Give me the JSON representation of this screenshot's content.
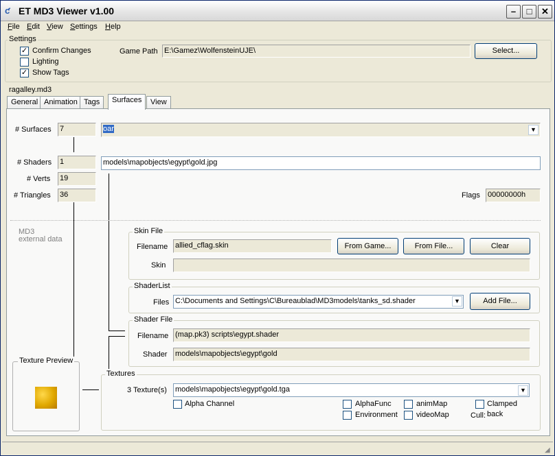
{
  "window": {
    "title": "ET MD3 Viewer v1.00"
  },
  "menu": [
    "File",
    "Edit",
    "View",
    "Settings",
    "Help"
  ],
  "settings": {
    "group_title": "Settings",
    "confirm_changes": {
      "label": "Confirm Changes",
      "checked": true
    },
    "lighting": {
      "label": "Lighting",
      "checked": false
    },
    "show_tags": {
      "label": "Show Tags",
      "checked": true
    },
    "game_path_label": "Game Path",
    "game_path_value": "E:\\Gamez\\WolfensteinUJE\\",
    "select_button": "Select..."
  },
  "file_name": "ragalley.md3",
  "tabs": [
    "General",
    "Animation",
    "Tags",
    "Surfaces",
    "View"
  ],
  "active_tab": "Surfaces",
  "surfaces": {
    "surfaces_label": "# Surfaces",
    "surfaces_value": "7",
    "surface_name": "oar",
    "shaders_label": "# Shaders",
    "shaders_value": "1",
    "shader_path": "models\\mapobjects\\egypt\\gold.jpg",
    "verts_label": "# Verts",
    "verts_value": "19",
    "triangles_label": "# Triangles",
    "triangles_value": "36",
    "flags_label": "Flags",
    "flags_value": "00000000h",
    "md3_line1": "MD3",
    "md3_line2": "external data",
    "texture_preview_title": "Texture Preview"
  },
  "skin_file": {
    "title": "Skin File",
    "filename_label": "Filename",
    "filename_value": "allied_cflag.skin",
    "from_game": "From Game...",
    "from_file": "From File...",
    "clear": "Clear",
    "skin_label": "Skin",
    "skin_value": ""
  },
  "shader_list": {
    "title": "ShaderList",
    "files_label": "Files",
    "files_value": "C:\\Documents and Settings\\C\\Bureaublad\\MD3models\\tanks_sd.shader",
    "add_file": "Add File..."
  },
  "shader_file": {
    "title": "Shader File",
    "filename_label": "Filename",
    "filename_value": "(map.pk3) scripts\\egypt.shader",
    "shader_label": "Shader",
    "shader_value": "models\\mapobjects\\egypt\\gold"
  },
  "textures": {
    "title": "Textures",
    "count_label": "3 Texture(s)",
    "texture_value": "models\\mapobjects\\egypt\\gold.tga",
    "alpha_channel": "Alpha Channel",
    "alpha_func": "AlphaFunc",
    "environment": "Environment",
    "anim_map": "animMap",
    "video_map": "videoMap",
    "clamped": "Clamped",
    "cull_label": "Cull:",
    "cull_value": "back"
  }
}
